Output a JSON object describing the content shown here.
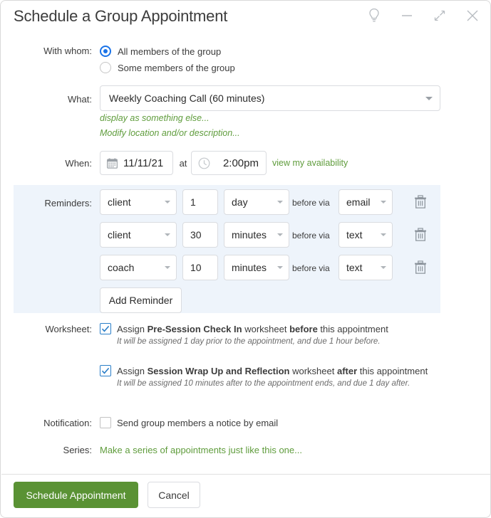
{
  "window": {
    "title": "Schedule a Group Appointment",
    "controls": [
      {
        "name": "lightbulb-icon",
        "label": "Tips"
      },
      {
        "name": "minimize-icon",
        "label": "Minimize"
      },
      {
        "name": "restore-icon",
        "label": "Restore"
      },
      {
        "name": "close-icon",
        "label": "Close"
      }
    ]
  },
  "with_whom": {
    "label": "With whom:",
    "options": [
      {
        "label": "All members of the group",
        "selected": true
      },
      {
        "label": "Some members of the group",
        "selected": false
      }
    ]
  },
  "what": {
    "label": "What:",
    "value": "Weekly Coaching Call (60 minutes)",
    "links": [
      "display as something else...",
      "Modify location and/or description..."
    ]
  },
  "when": {
    "label": "When:",
    "date": "11/11/21",
    "at": "at",
    "time": "2:00pm",
    "availability_link": "view my availability"
  },
  "reminders": {
    "label": "Reminders:",
    "before_via": "before via",
    "add_button": "Add Reminder",
    "rows": [
      {
        "who": "client",
        "amount": "1",
        "unit": "day",
        "channel": "email"
      },
      {
        "who": "client",
        "amount": "30",
        "unit": "minutes",
        "channel": "text"
      },
      {
        "who": "coach",
        "amount": "10",
        "unit": "minutes",
        "channel": "text"
      }
    ]
  },
  "worksheet": {
    "label": "Worksheet:",
    "items": [
      {
        "checked": true,
        "prefix": "Assign ",
        "name": "Pre-Session Check In",
        "middle": " worksheet ",
        "when": "before",
        "suffix": " this appointment",
        "note": "It will be assigned 1 day prior to the appointment, and due 1 hour before."
      },
      {
        "checked": true,
        "prefix": "Assign ",
        "name": "Session Wrap Up and Reflection",
        "middle": " worksheet ",
        "when": "after",
        "suffix": " this appointment",
        "note": "It will be assigned 10 minutes after to the appointment ends, and due 1 day after."
      }
    ]
  },
  "notification": {
    "label": "Notification:",
    "checked": false,
    "text": "Send group members a notice by email"
  },
  "series": {
    "label": "Series:",
    "link": "Make a series of appointments just like this one..."
  },
  "footer": {
    "primary": "Schedule Appointment",
    "secondary": "Cancel"
  },
  "colors": {
    "accent_green": "#5a9234",
    "link_green": "#5f9c3c",
    "radio_blue": "#1a73e8",
    "check_blue": "#2a7ec8",
    "panel_blue": "#eef4fb"
  }
}
